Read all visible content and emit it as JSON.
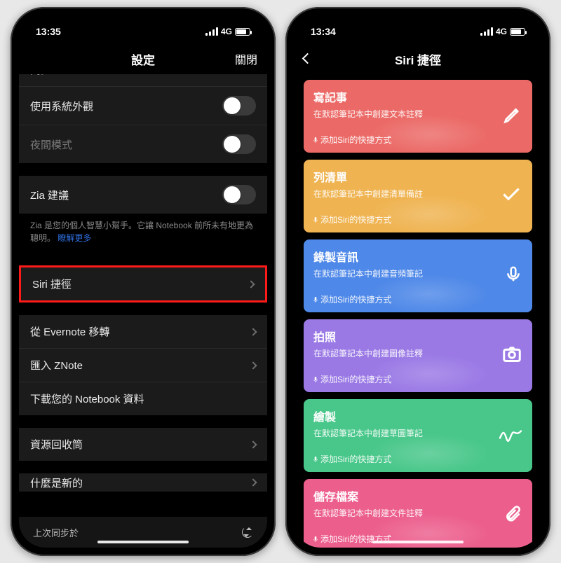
{
  "status": {
    "net": "4G"
  },
  "left": {
    "time": "13:35",
    "title": "設定",
    "close": "關閉",
    "rows": {
      "sync_partial": "同步",
      "system_appearance": "使用系統外觀",
      "night_mode": "夜間模式",
      "zia": "Zia 建議",
      "zia_note_pre": "Zia 是您的個人智慧小幫手。它讓 Notebook 前所未有地更為聰明。",
      "zia_note_link": "瞭解更多",
      "siri": "Siri 捷徑",
      "evernote": "從 Evernote 移轉",
      "znote": "匯入 ZNote",
      "download": "下載您的 Notebook 資料",
      "trash": "資源回收筒",
      "whatsnew": "什麼是新的",
      "last_sync": "上次同步於"
    }
  },
  "right": {
    "time": "13:34",
    "title": "Siri 捷徑",
    "siri_hint": "添加Siri的快捷方式",
    "cards": [
      {
        "title": "寫記事",
        "sub": "在默認筆記本中創建文本註釋",
        "color": "c-red",
        "icon": "pencil",
        "name": "write-note-card"
      },
      {
        "title": "列清單",
        "sub": "在默認筆記本中創建清單備註",
        "color": "c-yellow",
        "icon": "check",
        "name": "checklist-card"
      },
      {
        "title": "錄製音訊",
        "sub": "在默認筆記本中創建音頻筆記",
        "color": "c-blue",
        "icon": "mic",
        "name": "audio-card"
      },
      {
        "title": "拍照",
        "sub": "在默認筆記本中創建圖像註釋",
        "color": "c-purple",
        "icon": "camera",
        "name": "photo-card"
      },
      {
        "title": "繪製",
        "sub": "在默認筆記本中創建草圖筆記",
        "color": "c-green",
        "icon": "sketch",
        "name": "sketch-card"
      },
      {
        "title": "儲存檔案",
        "sub": "在默認筆記本中創建文件註釋",
        "color": "c-pink",
        "icon": "clip",
        "name": "file-card"
      }
    ]
  }
}
